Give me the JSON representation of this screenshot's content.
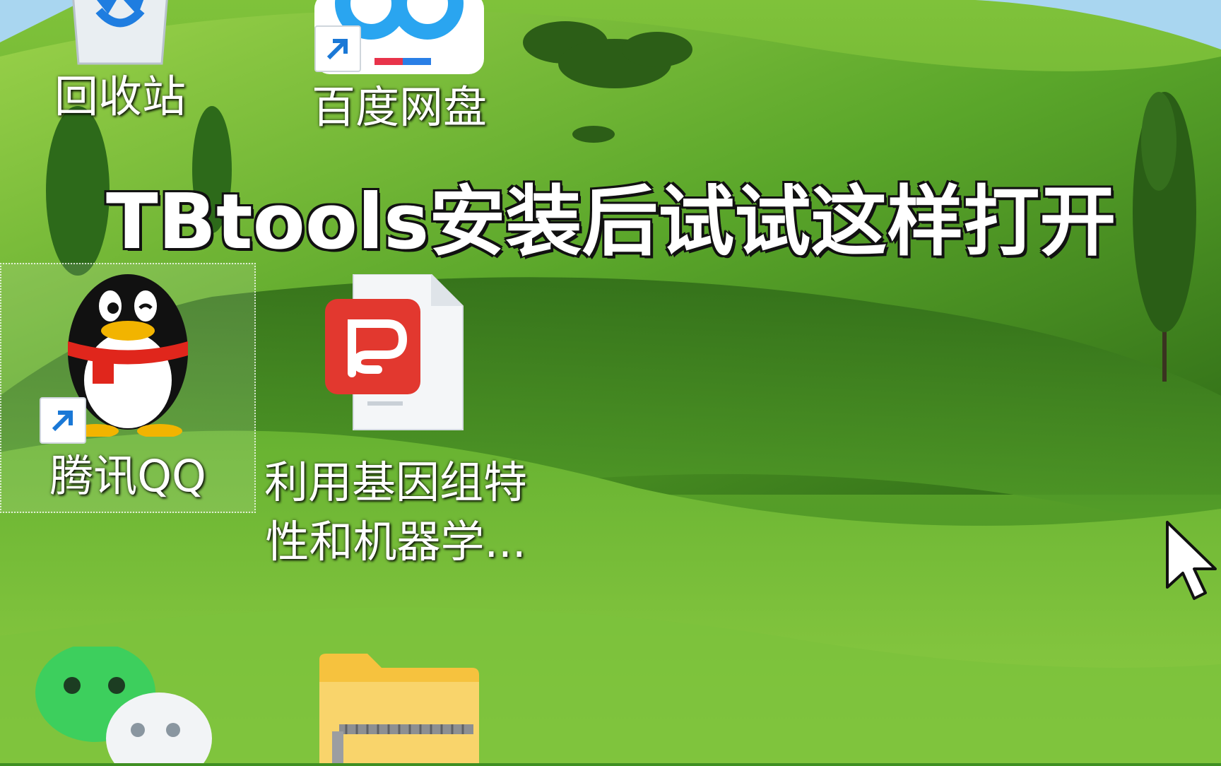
{
  "caption": "TBtools安装后试试这样打开",
  "colors": {
    "sky": "#9fd3f2",
    "grass_light": "#8cc63f",
    "grass_dark": "#2f6b1a",
    "caption_text": "#ffffff",
    "caption_outline": "#111111",
    "pdf_red": "#e2382f",
    "wechat_green": "#3dcf5d",
    "folder_yellow": "#f6c23e"
  },
  "desktop_icons": [
    {
      "label": "回收站",
      "icon": "recycle-bin-icon",
      "shortcut": false
    },
    {
      "label": "百度网盘",
      "icon": "baidu-netdisk-icon",
      "shortcut": true
    },
    {
      "label": "腾讯QQ",
      "icon": "qq-penguin-icon",
      "shortcut": true,
      "selected": true
    },
    {
      "label_line1": "利用基因组特",
      "label_line2": "性和机器学...",
      "icon": "pdf-document-icon",
      "shortcut": false
    },
    {
      "label": "",
      "icon": "wechat-icon",
      "shortcut": true
    },
    {
      "label": "",
      "icon": "zip-folder-icon",
      "shortcut": false
    }
  ]
}
